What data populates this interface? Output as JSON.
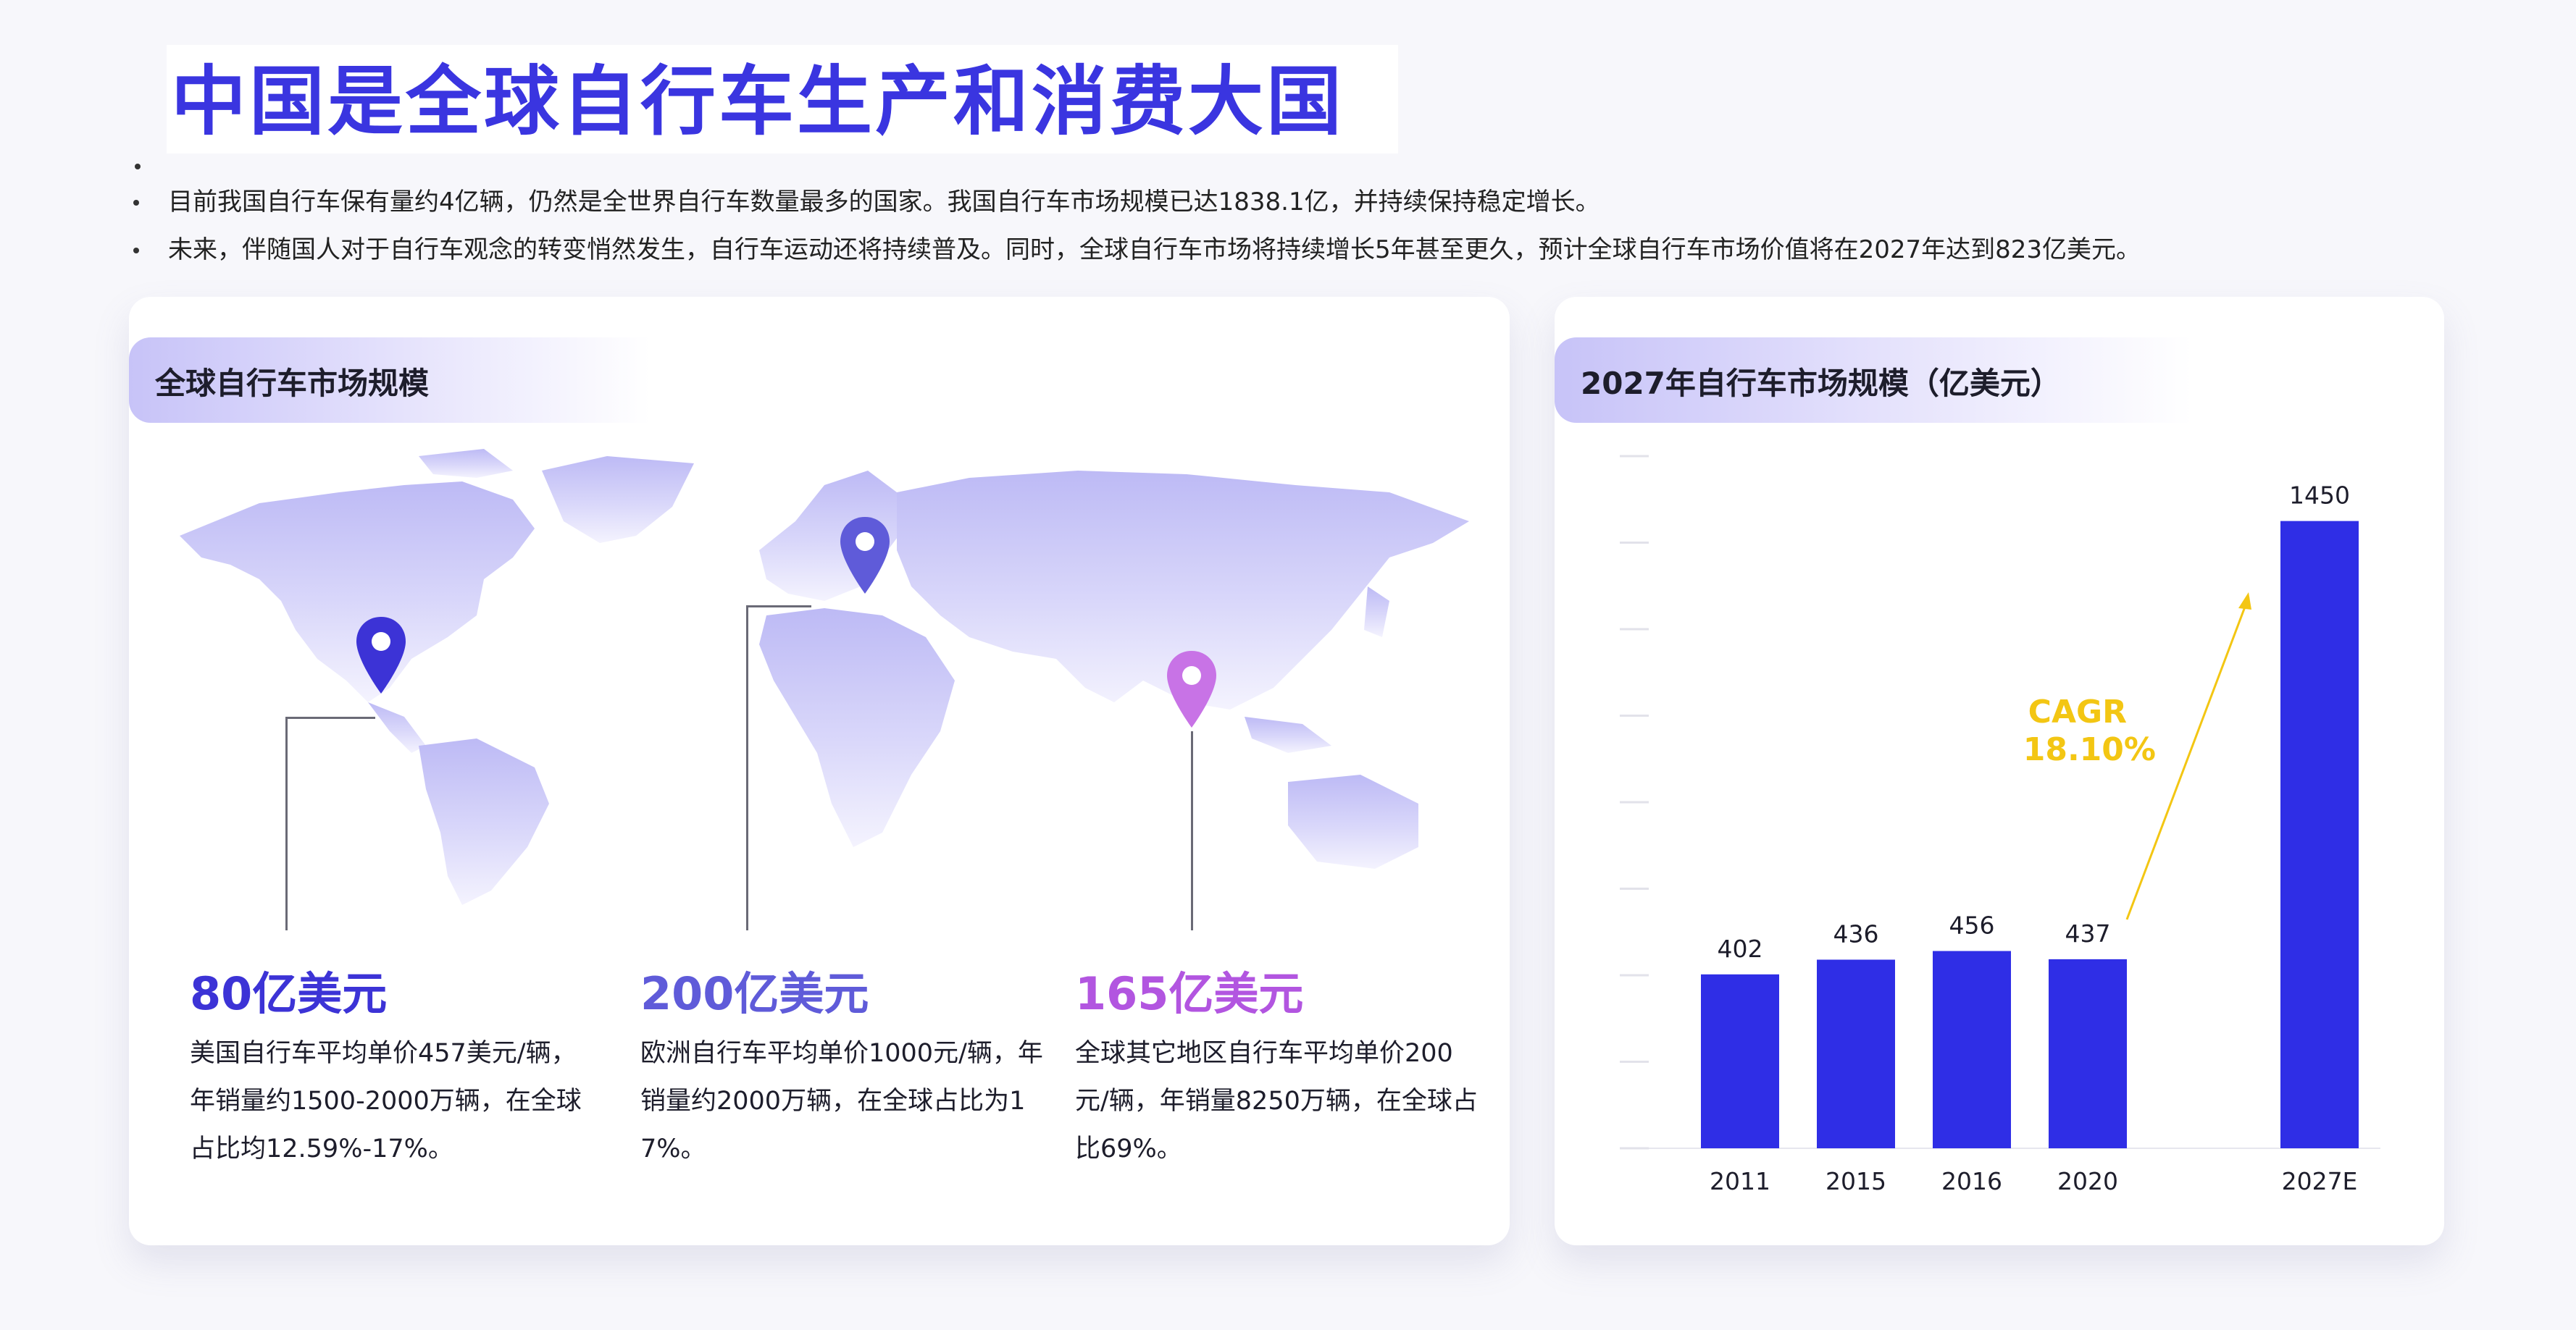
{
  "page": {
    "title": "中国是全球自行车生产和消费大国",
    "bullets": [
      "目前我国自行车保有量约4亿辆，仍然是全世界自行车数量最多的国家。我国自行车市场规模已达1838.1亿，并持续保持稳定增长。",
      "未来，伴随国人对于自行车观念的转变悄然发生，自行车运动还将持续普及。同时，全球自行车市场将持续增长5年甚至更久，预计全球自行车市场价值将在2027年达到823亿美元。"
    ]
  },
  "map_panel": {
    "title": "全球自行车市场规模",
    "regions": [
      {
        "value": "80亿美元",
        "desc": "美国自行车平均单价457美元/辆，年销量约1500-2000万辆，在全球占比均12.59%-17%。",
        "color": "#3c33d6"
      },
      {
        "value": "200亿美元",
        "desc": "欧洲自行车平均单价1000元/辆，年销量约2000万辆，在全球占比为17%。",
        "color": "#5f5bd9"
      },
      {
        "value": "165亿美元",
        "desc": "全球其它地区自行车平均单价200元/辆，年销量8250万辆，在全球占比69%。",
        "color": "#b255e0"
      }
    ],
    "icons": [
      "map-pin-icon",
      "map-pin-icon",
      "map-pin-icon"
    ]
  },
  "chart_panel": {
    "title": "2027年自行车市场规模（亿美元）",
    "annotation": {
      "line1": "CAGR",
      "line2": "18.10%",
      "color": "#f3c613"
    }
  },
  "chart_data": {
    "type": "bar",
    "title": "2027年自行车市场规模（亿美元）",
    "categories": [
      "2011",
      "2015",
      "2016",
      "2020",
      "2027E"
    ],
    "values": [
      402,
      436,
      456,
      437,
      1450
    ],
    "data_labels": [
      "402",
      "436",
      "456",
      "437",
      "1450"
    ],
    "ylim": [
      0,
      1600
    ],
    "bar_color": "#2f2ee6",
    "grid": false,
    "legend": "none"
  }
}
